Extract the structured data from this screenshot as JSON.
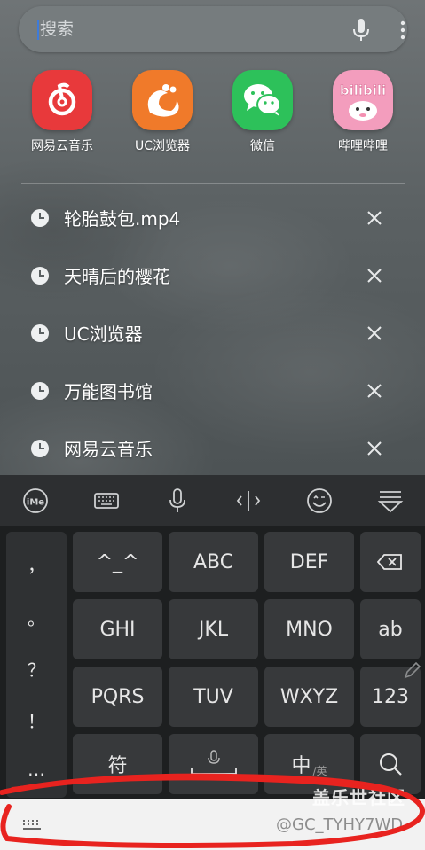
{
  "search": {
    "placeholder": "搜索",
    "mic_icon": "microphone-icon",
    "more_icon": "more-vertical-icon"
  },
  "apps": [
    {
      "label": "网易云音乐",
      "icon": "netease-music-icon",
      "color": "#e83a3a"
    },
    {
      "label": "UC浏览器",
      "icon": "uc-browser-icon",
      "color": "#f07a2a"
    },
    {
      "label": "微信",
      "icon": "wechat-icon",
      "color": "#2dc15a"
    },
    {
      "label": "哔哩哔哩",
      "icon": "bilibili-icon",
      "color": "#f08ab0",
      "logo_text": "bilibili"
    }
  ],
  "history": [
    {
      "text": "轮胎鼓包.mp4"
    },
    {
      "text": "天晴后的樱花"
    },
    {
      "text": "UC浏览器"
    },
    {
      "text": "万能图书馆"
    },
    {
      "text": "网易云音乐"
    }
  ],
  "keyboard": {
    "toolbar_icons": [
      "ime-logo-icon",
      "keyboard-icon",
      "microphone-icon",
      "cursor-move-icon",
      "emoji-icon",
      "collapse-keyboard-icon"
    ],
    "punctuation": [
      "，",
      "。",
      "？",
      "！",
      "…"
    ],
    "rows": [
      [
        "^_^",
        "ABC",
        "DEF"
      ],
      [
        "GHI",
        "JKL",
        "MNO"
      ],
      [
        "PQRS",
        "TUV",
        "WXYZ"
      ]
    ],
    "right_keys": [
      "backspace",
      "ab",
      "123",
      "search"
    ],
    "symbol_key": "符",
    "lang_key": "中",
    "lang_key_sub": "/英",
    "colors": {
      "key_bg": "#37393b",
      "kb_bg": "#1d1f20",
      "toolbar_bg": "#2d2f31"
    }
  },
  "watermark": {
    "small": "@GC_TYHY7WD",
    "big": "盖乐世社区"
  },
  "annotation_color": "#e8231f"
}
